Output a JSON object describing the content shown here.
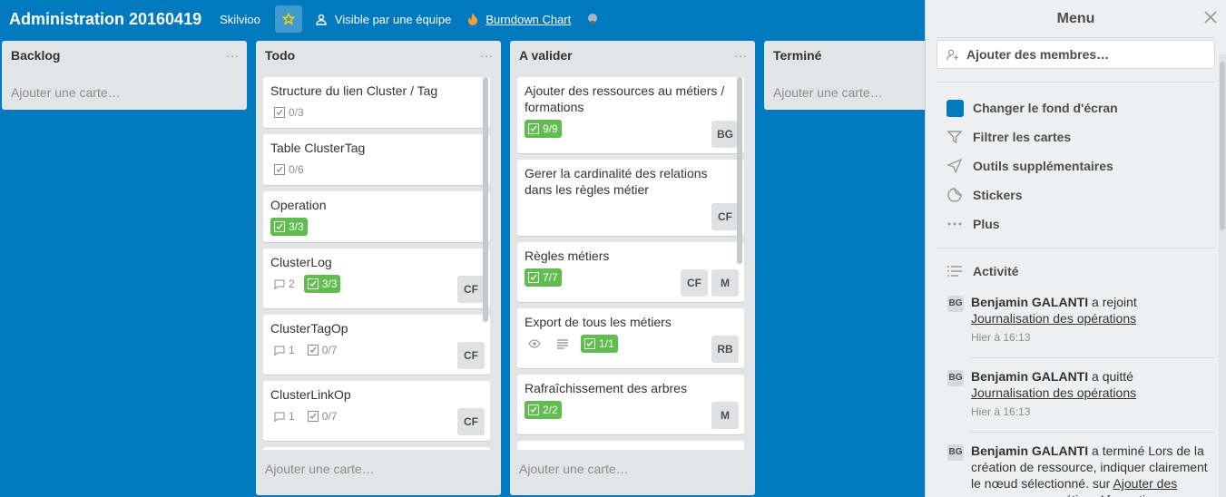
{
  "header": {
    "board_title": "Administration 20160419",
    "team": "Skilvioo",
    "visibility": "Visible par une équipe",
    "burndown": "Burndown Chart"
  },
  "lists": [
    {
      "title": "Backlog",
      "add_card": "Ajouter une carte…",
      "cards": []
    },
    {
      "title": "Todo",
      "add_card": "Ajouter une carte…",
      "cards": [
        {
          "title": "Structure du lien Cluster / Tag",
          "checklist": "0/3"
        },
        {
          "title": "Table ClusterTag",
          "checklist": "0/6"
        },
        {
          "title": "Operation",
          "checklist": "3/3",
          "done": true
        },
        {
          "title": "ClusterLog",
          "comments": "2",
          "checklist": "3/3",
          "done": true,
          "members": [
            "CF"
          ]
        },
        {
          "title": "ClusterTagOp",
          "comments": "1",
          "checklist": "0/7",
          "members": [
            "CF"
          ]
        },
        {
          "title": "ClusterLinkOp",
          "comments": "1",
          "checklist": "0/7",
          "members": [
            "CF"
          ]
        }
      ]
    },
    {
      "title": "A valider",
      "add_card": "Ajouter une carte…",
      "cards": [
        {
          "title": "Ajouter des ressources au métiers / formations",
          "checklist": "9/9",
          "done": true,
          "members": [
            "BG"
          ]
        },
        {
          "title": "Gerer la cardinalité des relations dans les règles métier",
          "members": [
            "CF"
          ]
        },
        {
          "title": "Règles métiers",
          "checklist": "7/7",
          "done": true,
          "members": [
            "CF",
            "M"
          ]
        },
        {
          "title": "Export de tous les métiers",
          "checklist": "1/1",
          "done": true,
          "members": [
            "RB"
          ]
        },
        {
          "title": "Rafraîchissement des arbres",
          "checklist": "2/2",
          "done": true,
          "members": [
            "M"
          ]
        }
      ]
    },
    {
      "title": "Terminé",
      "add_card": "Ajouter une carte…",
      "cards": []
    }
  ],
  "menu": {
    "title": "Menu",
    "add_members": "Ajouter des membres…",
    "items": [
      "Changer le fond d'écran",
      "Filtrer les cartes",
      "Outils supplémentaires",
      "Stickers",
      "Plus"
    ],
    "activity_title": "Activité",
    "activities": [
      {
        "avatar": "BG",
        "user": "Benjamin GALANTI",
        "action": "a rejoint",
        "target": "Journalisation des opérations",
        "time": "Hier à 16:13"
      },
      {
        "avatar": "BG",
        "user": "Benjamin GALANTI",
        "action": "a quitté",
        "target": "Journalisation des opérations",
        "time": "Hier à 16:13"
      },
      {
        "avatar": "BG",
        "user": "Benjamin GALANTI",
        "action": "a terminé Lors de la création de ressource, indiquer clairement le nœud sélectionné. sur",
        "target": "Ajouter des ressources au métiers / formations",
        "time": ""
      }
    ]
  },
  "colors": {
    "board_bg": "#0079bf",
    "done_badge": "#61bd4f"
  }
}
